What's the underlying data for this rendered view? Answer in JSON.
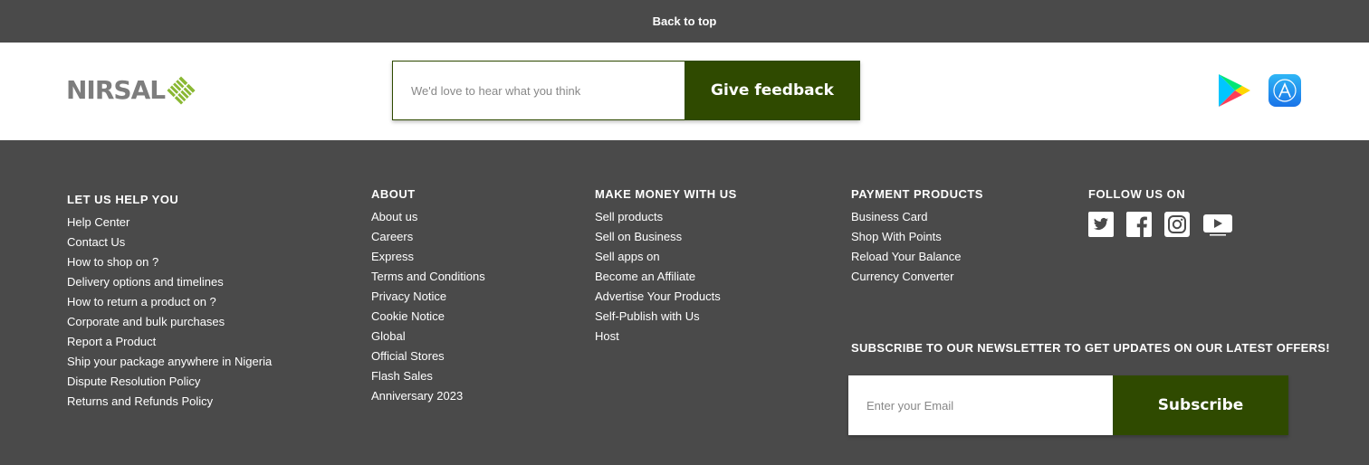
{
  "back_to_top": "Back to top",
  "brand": {
    "name": "NIRSAL",
    "accent": "#8ab833"
  },
  "feedback": {
    "placeholder": "We'd love to hear what you think",
    "button": "Give feedback"
  },
  "stores": {
    "google_play_icon": "google-play-icon",
    "app_store_icon": "app-store-icon"
  },
  "columns": {
    "help": {
      "title": "LET US HELP YOU",
      "links": [
        "Help Center",
        "Contact Us",
        "How to shop on ?",
        "Delivery options and timelines",
        "How to return a product on ?",
        "Corporate and bulk purchases",
        "Report a Product",
        "Ship your package anywhere in Nigeria",
        "Dispute Resolution Policy",
        "Returns and Refunds Policy"
      ]
    },
    "about": {
      "title": "ABOUT",
      "links": [
        "About us",
        "Careers",
        "Express",
        "Terms and Conditions",
        "Privacy Notice",
        "Cookie Notice",
        "Global",
        "Official Stores",
        "Flash Sales",
        "Anniversary 2023"
      ]
    },
    "money": {
      "title": "MAKE MONEY WITH US",
      "links": [
        "Sell products",
        "Sell on Business",
        "Sell apps on",
        "Become an Affiliate",
        "Advertise Your Products",
        "Self-Publish with Us",
        "Host"
      ]
    },
    "payment": {
      "title": "PAYMENT PRODUCTS",
      "links": [
        "Business Card",
        "Shop With Points",
        "Reload Your Balance",
        "Currency Converter"
      ]
    },
    "follow": {
      "title": "FOLLOW US ON",
      "icons": [
        "twitter-icon",
        "facebook-icon",
        "instagram-icon",
        "youtube-icon"
      ]
    }
  },
  "newsletter": {
    "title": "SUBSCRIBE TO OUR NEWSLETTER TO GET UPDATES ON OUR LATEST OFFERS!",
    "placeholder": "Enter your Email",
    "button": "Subscribe"
  },
  "colors": {
    "background": "#4a4a4a",
    "button": "#2f4a00",
    "text": "#ffffff"
  }
}
